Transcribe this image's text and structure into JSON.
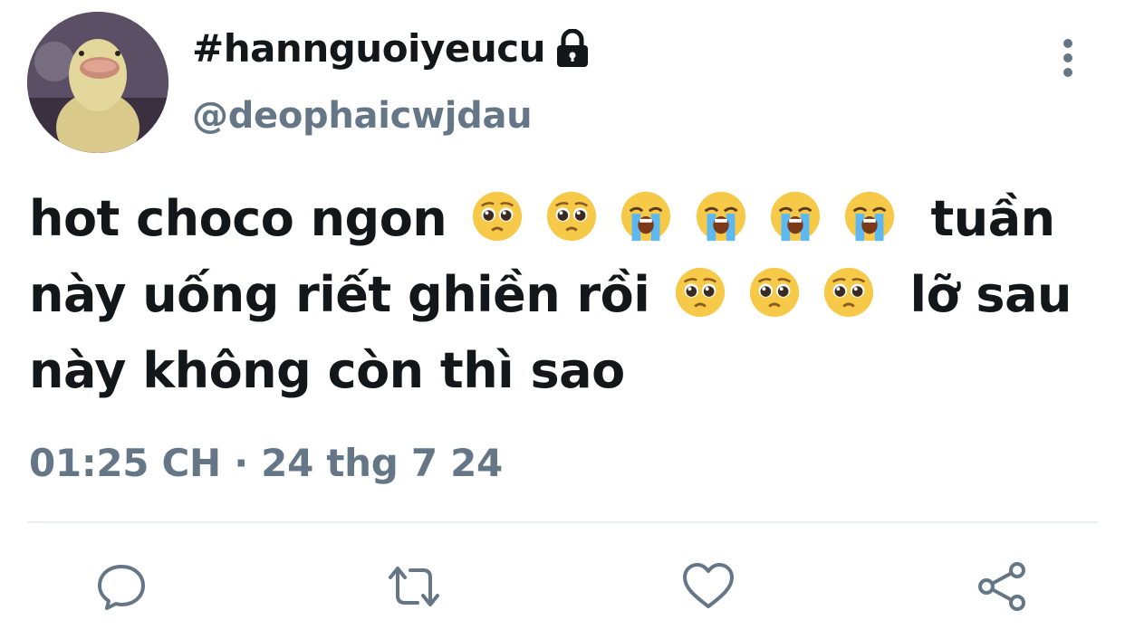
{
  "profile": {
    "display_name": "#hannguoiyeucu",
    "handle": "@deophaicwjdau",
    "protected": true
  },
  "tweet": {
    "line1_text": "hot choco ngon",
    "line1_emojis": [
      "pleading-face",
      "pleading-face",
      "loudly-crying-face",
      "loudly-crying-face",
      "loudly-crying-face",
      "loudly-crying-face"
    ],
    "line1_end": "tuần",
    "line2_text": "này uống riết ghiền rồi",
    "line2_emojis": [
      "pleading-face",
      "pleading-face",
      "pleading-face"
    ],
    "line2_end": "lỡ sau",
    "line3_text": "này không còn thì sao"
  },
  "meta": {
    "timestamp": "01:25 CH · 24 thg 7 24"
  },
  "actions": {
    "reply_icon": "reply-icon",
    "retweet_icon": "retweet-icon",
    "like_icon": "heart-icon",
    "share_icon": "share-icon"
  },
  "colors": {
    "text": "#14171a",
    "secondary": "#657786",
    "icon": "#657786",
    "divider": "#e6ecf0"
  }
}
